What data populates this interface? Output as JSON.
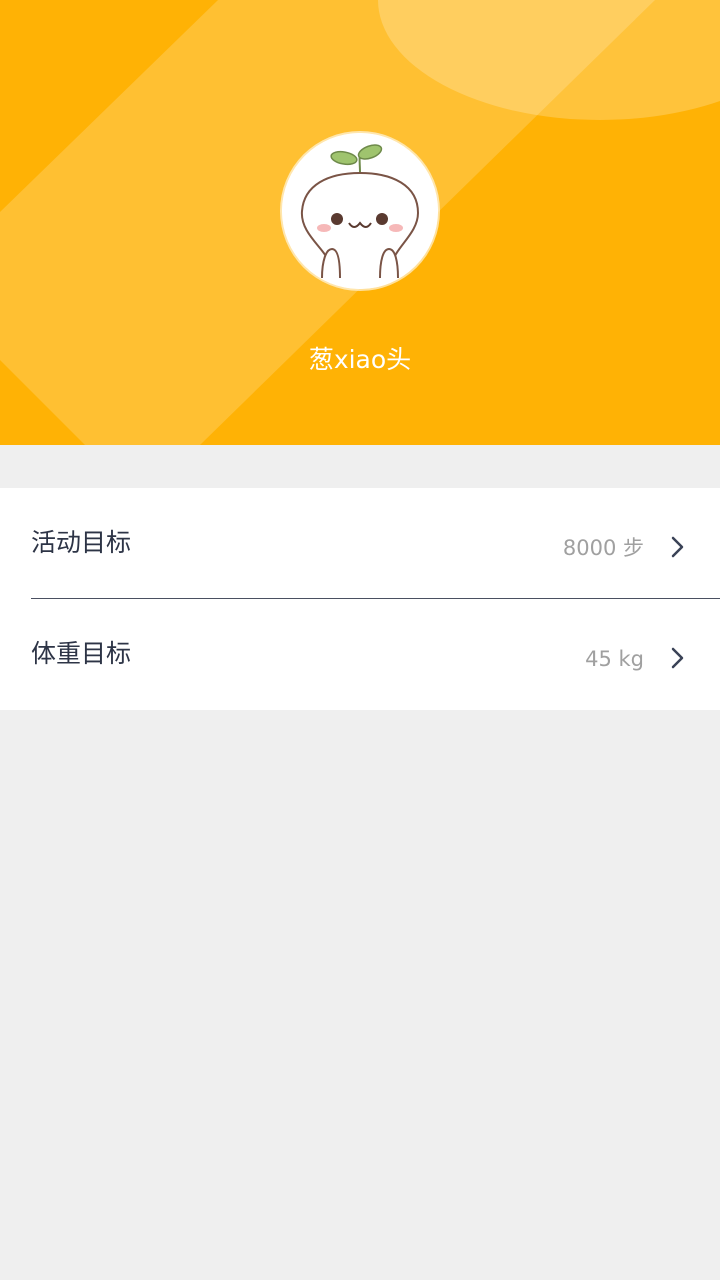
{
  "profile": {
    "username": "葱xiao头",
    "avatar_icon": "sprout-character-avatar"
  },
  "goals": {
    "activity": {
      "label": "活动目标",
      "value": "8000 步",
      "icon": "chevron-right-icon"
    },
    "weight": {
      "label": "体重目标",
      "value": "45 kg",
      "icon": "chevron-right-icon"
    }
  },
  "colors": {
    "header_background": "#ffb205",
    "page_background": "#efefef",
    "label_text": "#2d3446",
    "value_text": "#a0a0a0"
  }
}
